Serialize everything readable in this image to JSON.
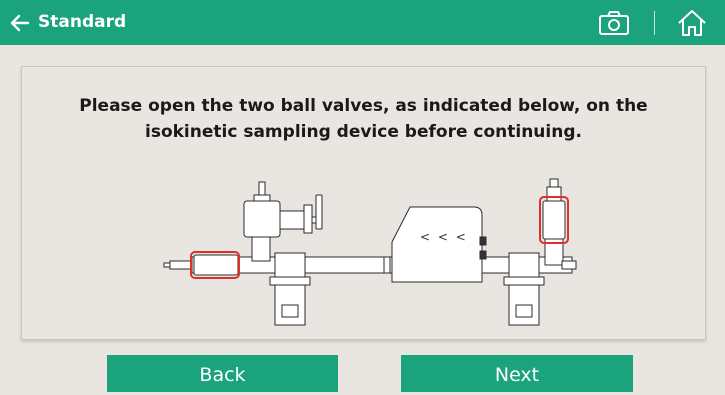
{
  "header": {
    "title": "Standard"
  },
  "icons": {
    "back": "back-arrow-icon",
    "camera": "camera-icon",
    "home": "home-icon"
  },
  "colors": {
    "accent": "#1aa37c",
    "highlight": "#e0302a",
    "background": "#e9e6e1"
  },
  "instruction": {
    "line1": "Please open the two ball valves, as indicated below, on the",
    "line2": "isokinetic sampling device before continuing."
  },
  "diagram": {
    "arrow_label": "< < <"
  },
  "buttons": {
    "back": "Back",
    "next": "Next"
  }
}
